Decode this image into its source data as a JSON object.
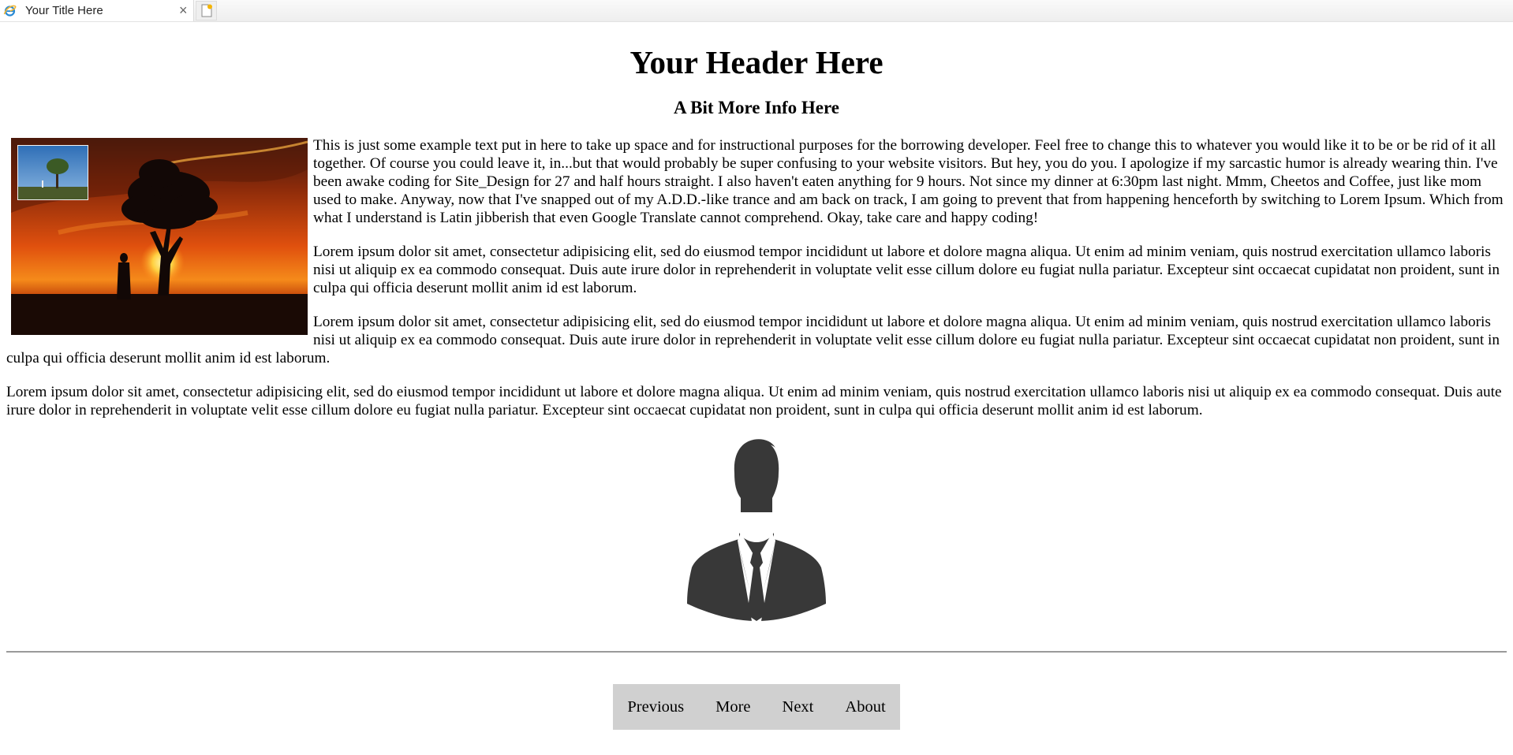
{
  "browser": {
    "tab_title": "Your Title Here",
    "close_symbol": "×",
    "favicon": "ie-icon",
    "new_tab_icon": "new-tab-icon"
  },
  "page": {
    "header": "Your Header Here",
    "subheader": "A Bit More Info Here",
    "paragraphs": [
      "This is just some example text put in here to take up space and for instructional purposes for the borrowing developer. Feel free to change this to whatever you would like it to be or be rid of it all together. Of course you could leave it, in...but that would probably be super confusing to your website visitors. But hey, you do you. I apologize if my sarcastic humor is already wearing thin. I've been awake coding for Site_Design for 27 and half hours straight. I also haven't eaten anything for 9 hours. Not since my dinner at 6:30pm last night. Mmm, Cheetos and Coffee, just like mom used to make. Anyway, now that I've snapped out of my A.D.D.-like trance and am back on track, I am going to prevent that from happening henceforth by switching to Lorem Ipsum. Which from what I understand is Latin jibberish that even Google Translate cannot comprehend. Okay, take care and happy coding!",
      "Lorem ipsum dolor sit amet, consectetur adipisicing elit, sed do eiusmod tempor incididunt ut labore et dolore magna aliqua. Ut enim ad minim veniam, quis nostrud exercitation ullamco laboris nisi ut aliquip ex ea commodo consequat. Duis aute irure dolor in reprehenderit in voluptate velit esse cillum dolore eu fugiat nulla pariatur. Excepteur sint occaecat cupidatat non proident, sunt in culpa qui officia deserunt mollit anim id est laborum.",
      "Lorem ipsum dolor sit amet, consectetur adipisicing elit, sed do eiusmod tempor incididunt ut labore et dolore magna aliqua. Ut enim ad minim veniam, quis nostrud exercitation ullamco laboris nisi ut aliquip ex ea commodo consequat. Duis aute irure dolor in reprehenderit in voluptate velit esse cillum dolore eu fugiat nulla pariatur. Excepteur sint occaecat cupidatat non proident, sunt in culpa qui officia deserunt mollit anim id est laborum.",
      "Lorem ipsum dolor sit amet, consectetur adipisicing elit, sed do eiusmod tempor incididunt ut labore et dolore magna aliqua. Ut enim ad minim veniam, quis nostrud exercitation ullamco laboris nisi ut aliquip ex ea commodo consequat. Duis aute irure dolor in reprehenderit in voluptate velit esse cillum dolore eu fugiat nulla pariatur. Excepteur sint occaecat cupidatat non proident, sunt in culpa qui officia deserunt mollit anim id est laborum."
    ],
    "images": {
      "main_photo": "sunset-tree-silhouette-image",
      "thumbnail": "tree-field-thumbnail-image",
      "avatar": "person-silhouette-avatar"
    }
  },
  "nav": {
    "previous": "Previous",
    "more": "More",
    "next": "Next",
    "about": "About"
  },
  "colors": {
    "nav_background": "#d0d0d0",
    "rule": "#9a9a9a",
    "avatar": "#383838"
  }
}
